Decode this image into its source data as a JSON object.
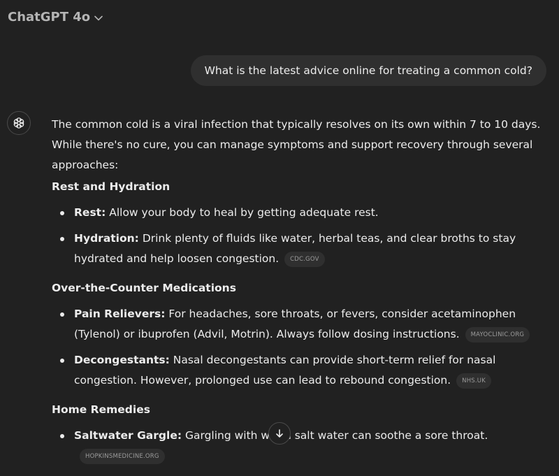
{
  "header": {
    "model_label": "ChatGPT 4o",
    "chevron_icon": "chevron-down-icon"
  },
  "user_message": {
    "text": "What is the latest advice online for treating a common cold?"
  },
  "assistant": {
    "avatar_icon": "openai-logo-icon",
    "intro": "The common cold is a viral infection that typically resolves on its own within 7 to 10 days. While there's no cure, you can manage symptoms and support recovery through several approaches:",
    "sections": [
      {
        "heading": "Rest and Hydration",
        "items": [
          {
            "term": "Rest:",
            "text": " Allow your body to heal by getting adequate rest.",
            "source": ""
          },
          {
            "term": "Hydration:",
            "text": " Drink plenty of fluids like water, herbal teas, and clear broths to stay hydrated and help loosen congestion.",
            "source": "CDC.GOV"
          }
        ]
      },
      {
        "heading": "Over-the-Counter Medications",
        "items": [
          {
            "term": "Pain Relievers:",
            "text": " For headaches, sore throats, or fevers, consider acetaminophen (Tylenol) or ibuprofen (Advil, Motrin). Always follow dosing instructions.",
            "source": "MAYOCLINIC.ORG"
          },
          {
            "term": "Decongestants:",
            "text": " Nasal decongestants can provide short-term relief for nasal congestion. However, prolonged use can lead to rebound congestion.",
            "source": "NHS.UK"
          }
        ]
      },
      {
        "heading": "Home Remedies",
        "items": [
          {
            "term": "Saltwater Gargle:",
            "text": " Gargling with warm salt water can soothe a sore throat.",
            "source": "HOPKINSMEDICINE.ORG"
          }
        ]
      }
    ]
  },
  "scroll_button": {
    "icon": "arrow-down-icon"
  },
  "colors": {
    "background": "#212121",
    "bubble": "#2f2f2f",
    "text": "#ececec",
    "muted": "#b4b4b4"
  }
}
